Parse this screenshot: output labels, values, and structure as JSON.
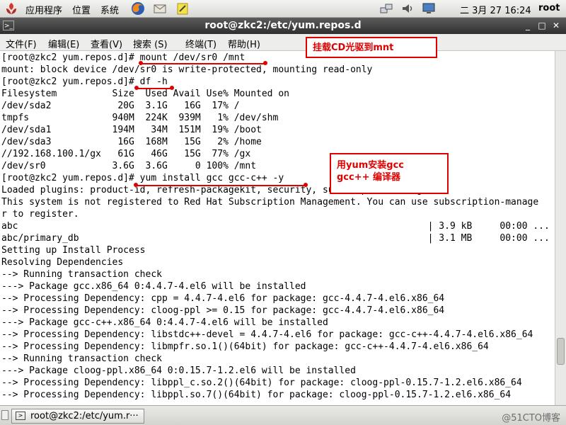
{
  "top_panel": {
    "applications": "应用程序",
    "places": "位置",
    "system": "系统",
    "clock": "二 3月 27 16:24",
    "user": "root",
    "icons": [
      "firefox-icon",
      "mail-icon",
      "notes-icon",
      "network-icon",
      "volume-icon",
      "display-icon"
    ]
  },
  "window": {
    "title": "root@zkc2:/etc/yum.repos.d"
  },
  "menubar": {
    "file": "文件(F)",
    "edit": "编辑(E)",
    "view": "查看(V)",
    "search": "搜索 (S)",
    "terminal": "终端(T)",
    "help": "帮助(H)"
  },
  "terminal": {
    "lines": [
      "[root@zkc2 yum.repos.d]# mount /dev/sr0 /mnt",
      "mount: block device /dev/sr0 is write-protected, mounting read-only",
      "[root@zkc2 yum.repos.d]# df -h",
      "Filesystem          Size  Used Avail Use% Mounted on",
      "/dev/sda2            20G  3.1G   16G  17% /",
      "tmpfs               940M  224K  939M   1% /dev/shm",
      "/dev/sda1           194M   34M  151M  19% /boot",
      "/dev/sda3            16G  168M   15G   2% /home",
      "//192.168.100.1/gx   61G   46G   15G  77% /gx",
      "/dev/sr0            3.6G  3.6G     0 100% /mnt",
      "[root@zkc2 yum.repos.d]# yum install gcc gcc-c++ -y",
      "Loaded plugins: product-id, refresh-packagekit, security, subscription-manager",
      "This system is not registered to Red Hat Subscription Management. You can use subscription-manage",
      "r to register.",
      "abc                                                                          | 3.9 kB     00:00 ...",
      "abc/primary_db                                                               | 3.1 MB     00:00 ...",
      "Setting up Install Process",
      "Resolving Dependencies",
      "--> Running transaction check",
      "---> Package gcc.x86_64 0:4.4.7-4.el6 will be installed",
      "--> Processing Dependency: cpp = 4.4.7-4.el6 for package: gcc-4.4.7-4.el6.x86_64",
      "--> Processing Dependency: cloog-ppl >= 0.15 for package: gcc-4.4.7-4.el6.x86_64",
      "---> Package gcc-c++.x86_64 0:4.4.7-4.el6 will be installed",
      "--> Processing Dependency: libstdc++-devel = 4.4.7-4.el6 for package: gcc-c++-4.4.7-4.el6.x86_64",
      "--> Processing Dependency: libmpfr.so.1()(64bit) for package: gcc-c++-4.4.7-4.el6.x86_64",
      "--> Running transaction check",
      "---> Package cloog-ppl.x86_64 0:0.15.7-1.2.el6 will be installed",
      "--> Processing Dependency: libppl_c.so.2()(64bit) for package: cloog-ppl-0.15.7-1.2.el6.x86_64",
      "--> Processing Dependency: libppl.so.7()(64bit) for package: cloog-ppl-0.15.7-1.2.el6.x86_64"
    ]
  },
  "annotations": {
    "mount_note": "挂载CD光驱到mnt",
    "yum_note": "用yum安装gcc\ngcc++ 编译器",
    "color": "#e00000"
  },
  "taskbar": {
    "task_label": "root@zkc2:/etc/yum.r···",
    "watermark": "@51CTO博客"
  }
}
